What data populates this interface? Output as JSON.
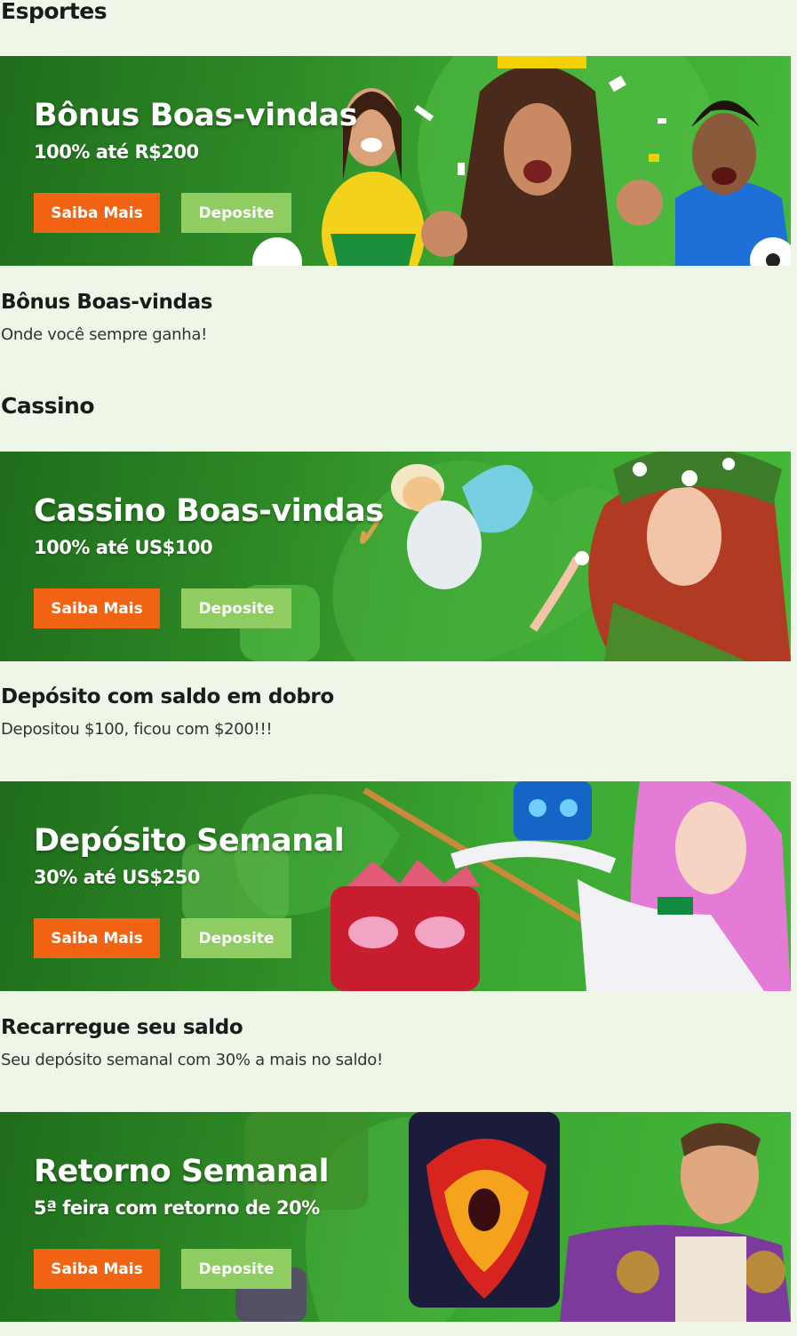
{
  "sections": {
    "sports": "Esportes",
    "casino": "Cassino"
  },
  "promos": [
    {
      "headline": "Bônus Boas-vindas",
      "subline": "100% até R$200",
      "more_label": "Saiba Mais",
      "deposit_label": "Deposite",
      "title": "Bônus Boas-vindas",
      "description": "Onde você sempre ganha!",
      "artwork": "celebrating-football-fans"
    },
    {
      "headline": "Cassino Boas-vindas",
      "subline": "100% até US$100",
      "more_label": "Saiba Mais",
      "deposit_label": "Deposite",
      "title": "Depósito com saldo em dobro",
      "description": "Depositou $100, ficou com $200!!!",
      "artwork": "fairy-and-forest-queen"
    },
    {
      "headline": "Depósito Semanal",
      "subline": "30% até US$250",
      "more_label": "Saiba Mais",
      "deposit_label": "Deposite",
      "title": "Recarregue seu saldo",
      "description": "Seu depósito semanal com 30% a mais no saldo!",
      "artwork": "tiki-masks-and-anime-heroine"
    },
    {
      "headline": "Retorno Semanal",
      "subline": "5ª feira com retorno de 20%",
      "more_label": "Saiba Mais",
      "deposit_label": "Deposite",
      "artwork": "fire-phoenix-and-roman-emperor"
    }
  ],
  "colors": {
    "page_bg": "#eef6e7",
    "banner_green": "#3ba531",
    "cta_orange": "#f06414",
    "cta_green": "#8fcc62"
  }
}
